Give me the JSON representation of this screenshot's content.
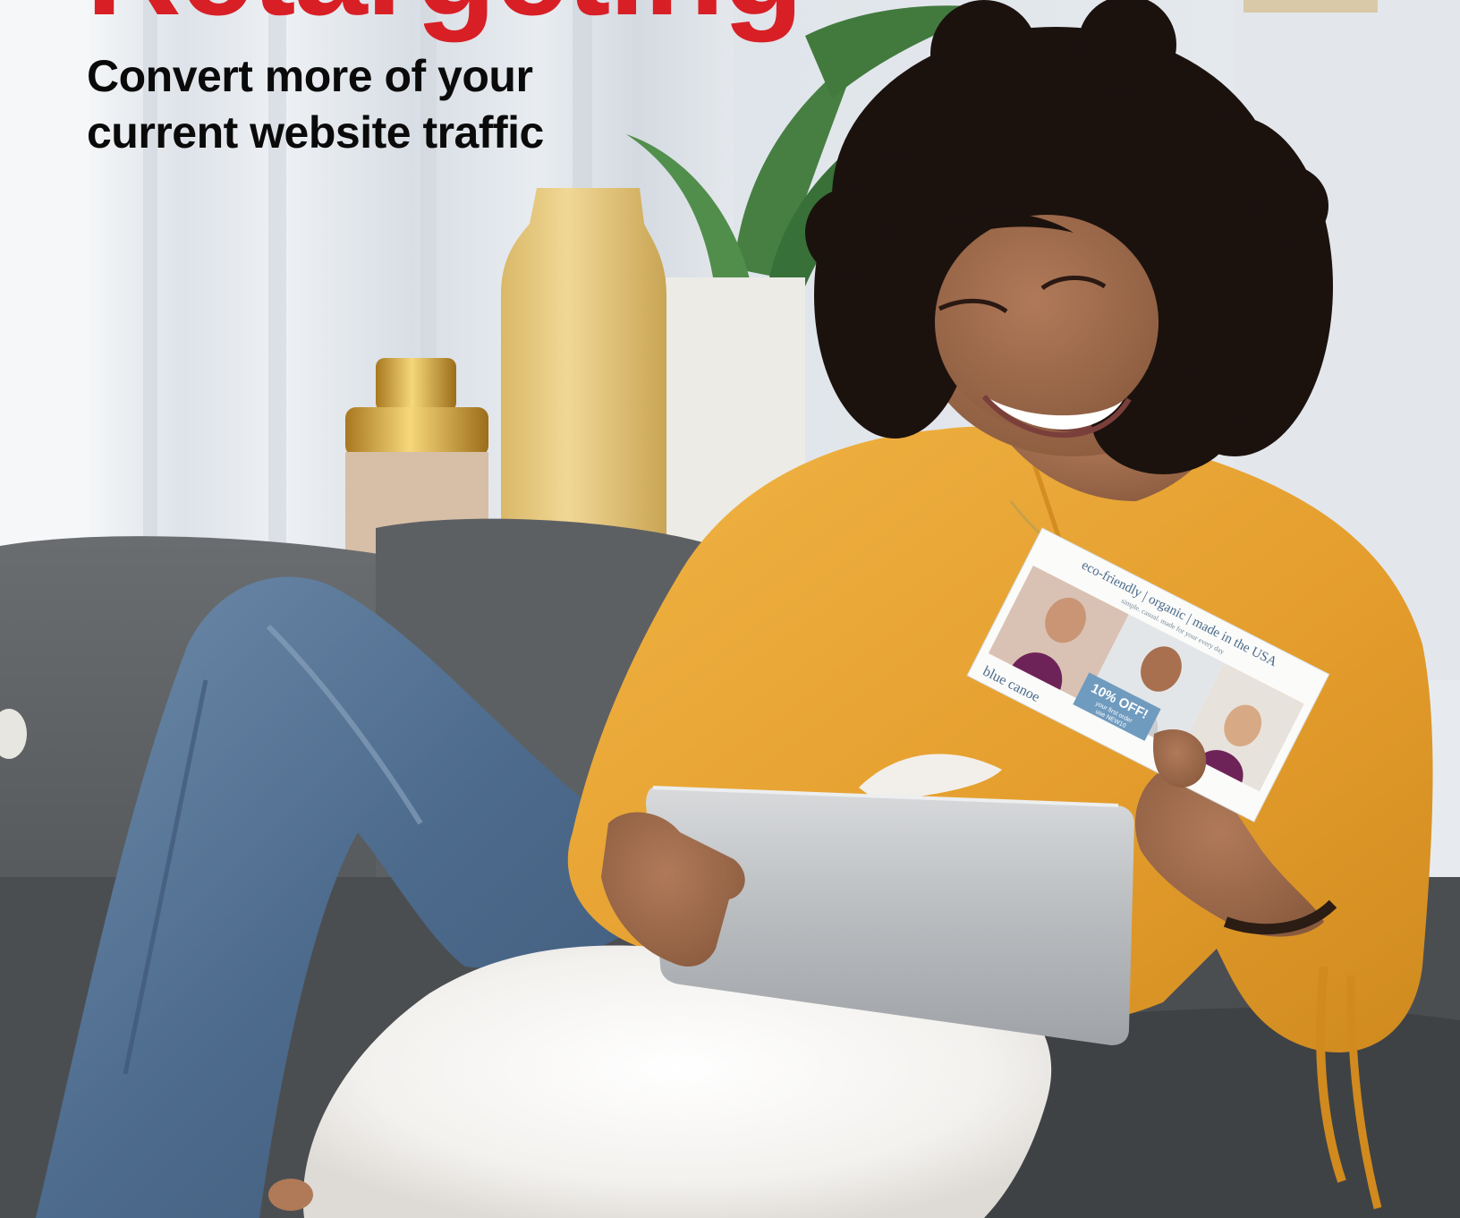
{
  "hero": {
    "headline": "Retargeting",
    "subhead_lines": [
      "Convert more of your",
      "current website traffic"
    ]
  },
  "postcard": {
    "tagline": "eco-friendly | organic | made in the USA",
    "subline": "simple. casual. made for your every day",
    "brand": "blue canoe",
    "offer": "10% OFF!",
    "offer_note": "your first order",
    "offer_code": "use NEW10"
  },
  "colors": {
    "headline": "#d81f26",
    "subhead": "#0a0a0a",
    "sweater": "#e7a12f",
    "sofa": "#56595c",
    "jeans": "#4f6f91"
  },
  "icons": []
}
